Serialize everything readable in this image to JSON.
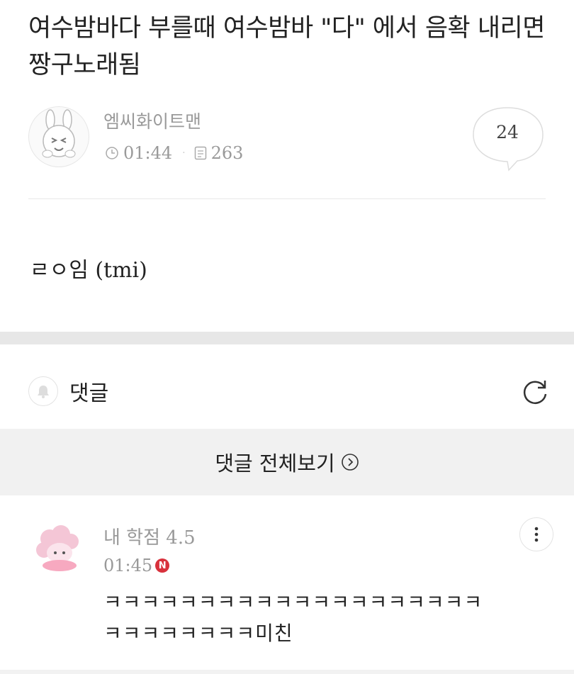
{
  "post": {
    "title": "여수밤바다 부를때 여수밤바 \"다\" 에서 음확 내리면 짱구노래됨",
    "author": "엠씨화이트맨",
    "time": "01:44",
    "views": "263",
    "comment_count": "24",
    "body_prefix": "ㄹㅇ임 ",
    "body_suffix": "(tmi)"
  },
  "comments_section": {
    "label": "댓글",
    "view_all_label": "댓글 전체보기"
  },
  "comment": {
    "author_prefix": "내 학점 ",
    "author_score": "4.5",
    "time": "01:45",
    "new_badge": "N",
    "text_line1": "ㅋㅋㅋㅋㅋㅋㅋㅋㅋㅋㅋㅋㅋㅋㅋㅋㅋㅋㅋㅋ",
    "text_line2": "ㅋㅋㅋㅋㅋㅋㅋㅋ미친"
  },
  "icons": {
    "avatar": "bunny-avatar-icon",
    "clock": "clock-icon",
    "views": "document-icon",
    "comments": "speech-bubble-icon",
    "bell": "bell-icon",
    "refresh": "refresh-icon",
    "chevron": "circle-chevron-right-icon",
    "more": "more-vertical-icon",
    "commenter": "pink-sheep-avatar-icon"
  },
  "colors": {
    "text": "#222222",
    "muted": "#999999",
    "section_gap": "#e7e7e7",
    "view_all_bg": "#f1f1f1",
    "new_badge": "#d8313c"
  }
}
